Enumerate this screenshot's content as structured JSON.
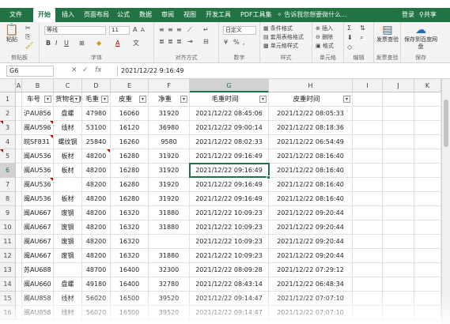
{
  "menubar": {
    "tabs": [
      "文件",
      "开始",
      "插入",
      "页面布局",
      "公式",
      "数据",
      "审阅",
      "视图",
      "开发工具",
      "PDF工具集"
    ],
    "active_tab": "开始",
    "tell_me": "告诉我您想要做什么...",
    "login": "登录",
    "share": "共享"
  },
  "ribbon": {
    "paste_label": "粘贴",
    "clipboard_group": "剪贴板",
    "font_name": "等线",
    "font_size": "11",
    "font_group": "字体",
    "align_group": "对齐方式",
    "number_format": "日定义",
    "number_group": "数字",
    "cond_format": "条件格式",
    "table_format": "套用表格格式",
    "cell_style": "单元格样式",
    "style_group": "样式",
    "insert": "插入",
    "delete": "删除",
    "format": "格式",
    "cells_group": "单元格",
    "edit_group": "编辑",
    "invoice_label": "发票查验",
    "invoice_group": "发票查验",
    "save_label": "保存到百度网盘",
    "save_group": "保存"
  },
  "formula_bar": {
    "name_box": "G6",
    "fx": "fx",
    "formula": "2021/12/22  9:16:49"
  },
  "columns": [
    "A",
    "B",
    "C",
    "D",
    "E",
    "F",
    "G",
    "H",
    "I",
    "J",
    "K"
  ],
  "selected_column": "G",
  "selected_row": "6",
  "headers": [
    "车号",
    "货物名称",
    "毛重",
    "皮重",
    "净重",
    "毛重时间",
    "皮重时间"
  ],
  "rows": [
    {
      "num": "2",
      "car": "沪AU856",
      "goods": "盘螺",
      "gross": "47980",
      "tare": "16060",
      "net": "31920",
      "gtime": "2021/12/22 08:45:06",
      "ttime": "2021/12/22 08:05:33"
    },
    {
      "num": "3",
      "car": "闽AU596",
      "goods": "线材",
      "gross": "53100",
      "tare": "16120",
      "net": "36980",
      "gtime": "2021/12/22 09:00:14",
      "ttime": "2021/12/22 08:18:36"
    },
    {
      "num": "4",
      "car": "皖SF831",
      "goods": "螺纹钢",
      "gross": "25840",
      "tare": "16260",
      "net": "9580",
      "gtime": "2021/12/22 08:02:33",
      "ttime": "2021/12/22 06:54:49"
    },
    {
      "num": "5",
      "car": "闽AU536",
      "goods": "板材",
      "gross": "48200",
      "tare": "16280",
      "net": "31920",
      "gtime": "2021/12/22 09:16:49",
      "ttime": "2021/12/22 08:16:40"
    },
    {
      "num": "6",
      "car": "闽AU536",
      "goods": "板材",
      "gross": "48200",
      "tare": "16280",
      "net": "31920",
      "gtime": "2021/12/22 09:16:49",
      "ttime": "2021/12/22 08:16:40"
    },
    {
      "num": "7",
      "car": "闽AU536",
      "goods": "",
      "gross": "48200",
      "tare": "16280",
      "net": "31920",
      "gtime": "2021/12/22 09:16:49",
      "ttime": "2021/12/22 08:16:40"
    },
    {
      "num": "8",
      "car": "闽AU536",
      "goods": "板材",
      "gross": "48200",
      "tare": "16280",
      "net": "31920",
      "gtime": "2021/12/22 09:16:49",
      "ttime": "2021/12/22 08:16:40"
    },
    {
      "num": "9",
      "car": "闽AU667",
      "goods": "废钢",
      "gross": "48200",
      "tare": "16320",
      "net": "31880",
      "gtime": "2021/12/22 10:09:23",
      "ttime": "2021/12/22 09:20:44"
    },
    {
      "num": "10",
      "car": "闽AU667",
      "goods": "废钢",
      "gross": "48200",
      "tare": "16320",
      "net": "31880",
      "gtime": "2021/12/22 10:09:23",
      "ttime": "2021/12/22 09:20:44"
    },
    {
      "num": "11",
      "car": "闽AU667",
      "goods": "废钢",
      "gross": "48200",
      "tare": "16320",
      "net": "",
      "gtime": "2021/12/22 10:09:23",
      "ttime": "2021/12/22 09:20:44"
    },
    {
      "num": "12",
      "car": "闽AU667",
      "goods": "废钢",
      "gross": "48200",
      "tare": "16320",
      "net": "31880",
      "gtime": "2021/12/22 10:09:23",
      "ttime": "2021/12/22 09:20:44"
    },
    {
      "num": "13",
      "car": "苏AU688",
      "goods": "",
      "gross": "48700",
      "tare": "16400",
      "net": "32300",
      "gtime": "2021/12/22 08:09:28",
      "ttime": "2021/12/22 07:29:12"
    },
    {
      "num": "14",
      "car": "闽AU660",
      "goods": "盘螺",
      "gross": "49180",
      "tare": "16400",
      "net": "32780",
      "gtime": "2021/12/22 08:43:14",
      "ttime": "2021/12/22 06:48:34"
    },
    {
      "num": "15",
      "car": "闽AU858",
      "goods": "线材",
      "gross": "56020",
      "tare": "16500",
      "net": "39520",
      "gtime": "2021/12/22 09:14:47",
      "ttime": "2021/12/22 07:07:10"
    },
    {
      "num": "16",
      "car": "闽AU858",
      "goods": "线材",
      "gross": "56020",
      "tare": "16500",
      "net": "39520",
      "gtime": "2021/12/22 09:14:47",
      "ttime": "2021/12/22 07:07:10"
    }
  ],
  "colors": {
    "accent": "#217346",
    "comment_marker": "#c00000"
  }
}
